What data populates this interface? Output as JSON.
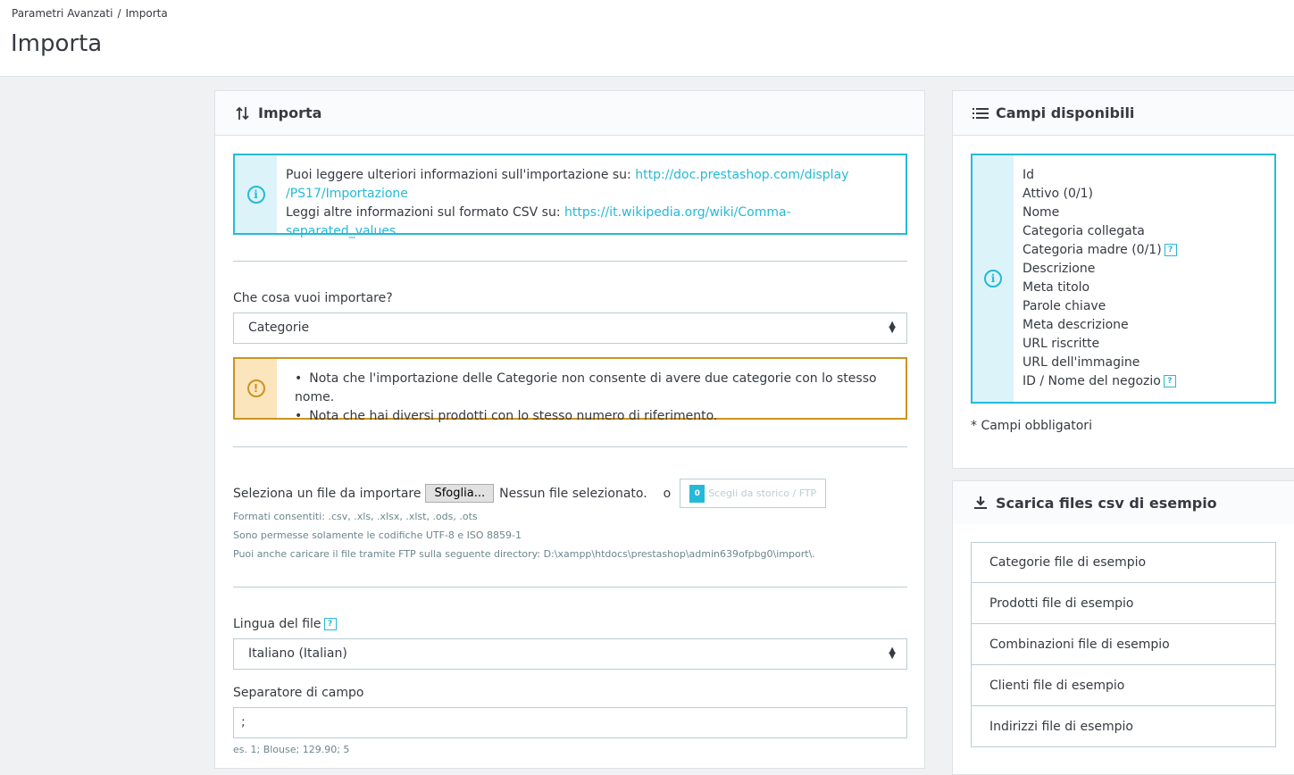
{
  "breadcrumb": [
    "Parametri Avanzati",
    "/",
    "Importa"
  ],
  "page_title": "Importa",
  "import_panel": {
    "heading": "Importa",
    "info": {
      "line1_text": "Puoi leggere ulteriori informazioni sull'importazione su: ",
      "line1_link_a": "http://doc.prestashop.com/display",
      "line1_link_b": "/PS17/Importazione",
      "line2_text": "Leggi altre informazioni sul formato CSV su: ",
      "line2_link": "https://it.wikipedia.org/wiki/Comma-separated_values"
    },
    "what_label": "Che cosa vuoi importare?",
    "what_value": "Categorie",
    "warnings": [
      "Nota che l'importazione delle Categorie non consente di avere due categorie con lo stesso nome.",
      "Nota che hai diversi prodotti con lo stesso numero di riferimento."
    ],
    "file_label": "Seleziona un file da importare",
    "browse_label": "Sfoglia...",
    "no_file": "Nessun file selezionato.",
    "or": "o",
    "ftp_count": "0",
    "ftp_label": "Scegli da storico / FTP",
    "help1": "Formati consentiti: .csv, .xls, .xlsx, .xlst, .ods, .ots",
    "help2": "Sono permesse solamente le codifiche UTF-8 e ISO 8859-1",
    "help3": "Puoi anche caricare il file tramite FTP sulla seguente directory: D:\\xampp\\htdocs\\prestashop\\admin639ofpbg0\\import\\.",
    "lang_label": "Lingua del file",
    "lang_value": "Italiano (Italian)",
    "sep_label": "Separatore di campo",
    "sep_value": ";",
    "sep_help": "es. 1; Blouse; 129.90; 5"
  },
  "fields_panel": {
    "heading": "Campi disponibili",
    "fields": [
      "Id",
      "Attivo (0/1)",
      "Nome",
      "Categoria collegata",
      "Categoria madre (0/1)",
      "Descrizione",
      "Meta titolo",
      "Parole chiave",
      "Meta descrizione",
      "URL riscritte",
      "URL dell'immagine",
      "ID / Nome del negozio"
    ],
    "required_note": "* Campi obbligatori"
  },
  "samples_panel": {
    "heading": "Scarica files csv di esempio",
    "items": [
      "Categorie file di esempio",
      "Prodotti file di esempio",
      "Combinazioni file di esempio",
      "Clienti file di esempio",
      "Indirizzi file di esempio"
    ]
  },
  "help_mark": "?",
  "colors": {
    "accent": "#25b9d7",
    "warning": "#cd9321"
  }
}
